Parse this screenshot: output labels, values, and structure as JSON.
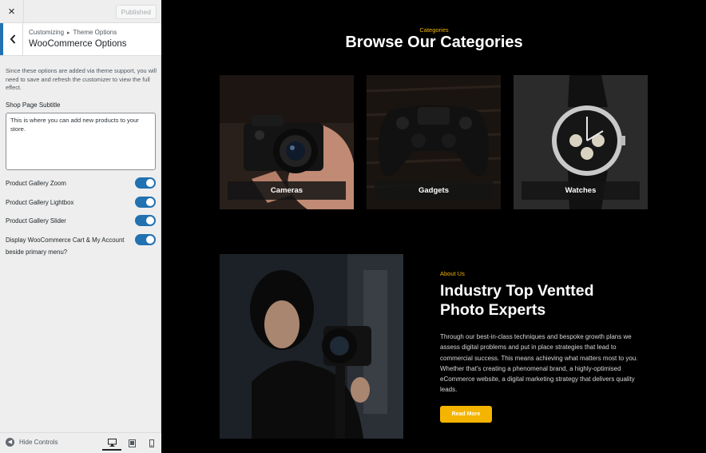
{
  "customizer": {
    "close_label": "×",
    "publish_label": "Published",
    "breadcrumb": [
      "Customizing",
      "Theme Options"
    ],
    "breadcrumb_separator": "▸",
    "section_title": "WooCommerce Options",
    "description": "Since these options are added via theme support, you will need to save and refresh the customizer to view the full effect.",
    "subtitle_field": {
      "label": "Shop Page Subtitle",
      "value": "This is where you can add new products to your store."
    },
    "toggles": [
      {
        "label": "Product Gallery Zoom",
        "enabled": true
      },
      {
        "label": "Product Gallery Lightbox",
        "enabled": true
      },
      {
        "label": "Product Gallery Slider",
        "enabled": true
      },
      {
        "label": "Display WooCommerce Cart & My Account beside primary menu?",
        "enabled": true
      }
    ],
    "footer": {
      "hide_controls_label": "Hide Controls",
      "devices": [
        "desktop-icon",
        "tablet-icon",
        "mobile-icon"
      ],
      "active_device": "desktop"
    },
    "accent_color": "#2271b1"
  },
  "preview": {
    "categories": {
      "eyebrow": "Categories",
      "heading": "Browse Our Categories",
      "items": [
        {
          "label": "Cameras"
        },
        {
          "label": "Gadgets"
        },
        {
          "label": "Watches"
        }
      ]
    },
    "about": {
      "eyebrow": "About Us",
      "title": "Industry Top Ventted Photo Experts",
      "body": "Through our best-in-class techniques and bespoke growth plans we assess digital problems and put in place strategies that lead to commercial success. This means achieving what matters most to you. Whether that's creating a phenomenal brand, a highly-optimised eCommerce website, a digital marketing strategy that delivers quality leads.",
      "button_label": "Read More"
    },
    "accent_color": "#f5b400"
  }
}
